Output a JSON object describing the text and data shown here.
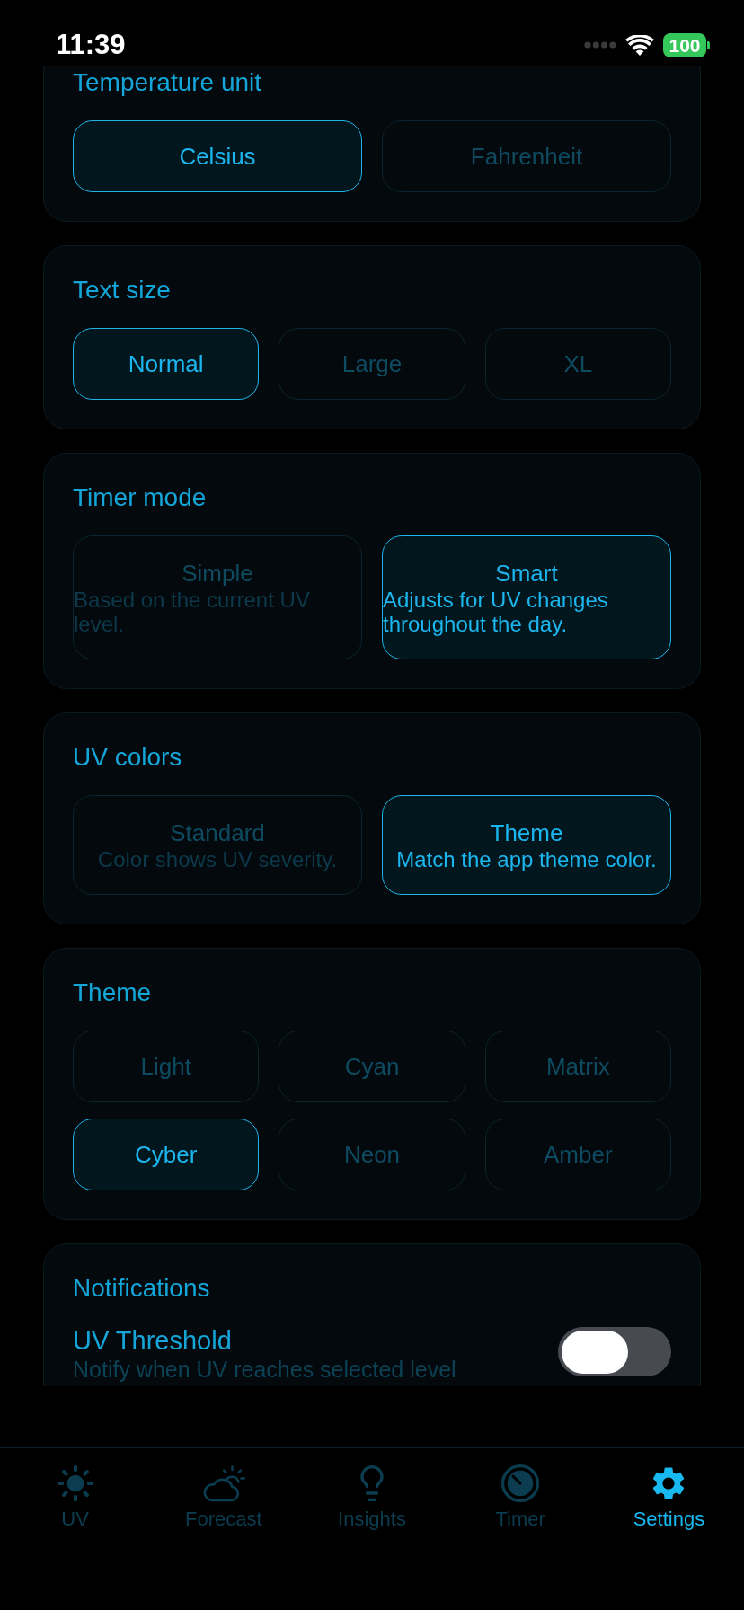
{
  "status_bar": {
    "time": "11:39",
    "battery": "100"
  },
  "sections": [
    {
      "kind": "choice",
      "title": "Temperature unit",
      "options": [
        {
          "label": "Celsius",
          "selected": true
        },
        {
          "label": "Fahrenheit",
          "selected": false
        }
      ]
    },
    {
      "kind": "choice",
      "title": "Text size",
      "options": [
        {
          "label": "Normal",
          "selected": true
        },
        {
          "label": "Large",
          "selected": false
        },
        {
          "label": "XL",
          "selected": false
        }
      ]
    },
    {
      "kind": "choice",
      "title": "Timer mode",
      "options": [
        {
          "label": "Simple",
          "description": "Based on the current UV level.",
          "selected": false
        },
        {
          "label": "Smart",
          "description": "Adjusts for UV changes throughout the day.",
          "selected": true
        }
      ]
    },
    {
      "kind": "choice",
      "title": "UV colors",
      "options": [
        {
          "label": "Standard",
          "description": "Color shows UV severity.",
          "selected": false
        },
        {
          "label": "Theme",
          "description": "Match the app theme color.",
          "selected": true
        }
      ]
    },
    {
      "kind": "choice",
      "title": "Theme",
      "options": [
        {
          "label": "Light",
          "selected": false
        },
        {
          "label": "Cyan",
          "selected": false
        },
        {
          "label": "Matrix",
          "selected": false
        },
        {
          "label": "Cyber",
          "selected": true
        },
        {
          "label": "Neon",
          "selected": false
        },
        {
          "label": "Amber",
          "selected": false
        }
      ]
    },
    {
      "kind": "toggles",
      "title": "Notifications",
      "items": [
        {
          "label": "UV Threshold",
          "description": "Notify when UV reaches selected level",
          "on": false
        }
      ]
    }
  ],
  "tab_bar": {
    "tabs": [
      {
        "label": "UV",
        "selected": false
      },
      {
        "label": "Forecast",
        "selected": false
      },
      {
        "label": "Insights",
        "selected": false
      },
      {
        "label": "Timer",
        "selected": false
      },
      {
        "label": "Settings",
        "selected": true
      }
    ]
  }
}
